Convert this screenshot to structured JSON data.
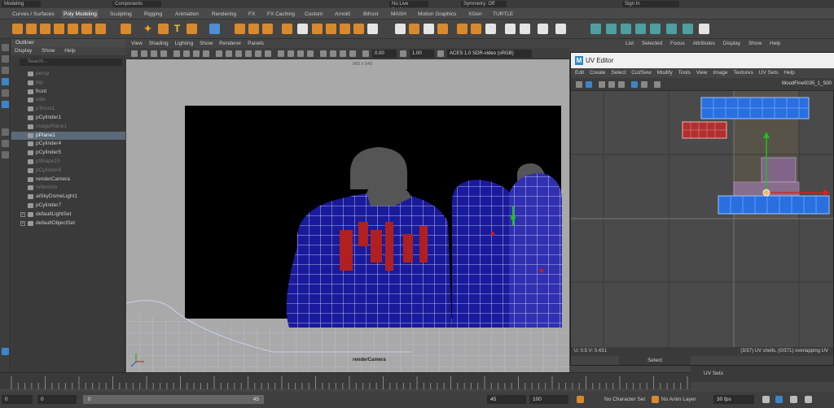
{
  "statusline": {
    "menuset": "Modeling",
    "components": "Components",
    "live_surface": "No Live Surface",
    "symmetry": "Symmetry: Off",
    "signin": "Sign In"
  },
  "shelf_tabs": [
    "Curves / Surfaces",
    "Poly Modeling",
    "Sculpting",
    "Rigging",
    "Animation",
    "Rendering",
    "FX",
    "FX Caching",
    "Custom",
    "Arnold",
    "Bifrost",
    "MASH",
    "Motion Graphics",
    "XGen",
    "TURTLE"
  ],
  "active_shelf_tab": "Poly Modeling",
  "outliner": {
    "title": "Outliner",
    "menu": [
      "Display",
      "Show",
      "Help"
    ],
    "search_placeholder": "Search...",
    "items": [
      {
        "label": "persp",
        "dim": true
      },
      {
        "label": "top",
        "dim": true
      },
      {
        "label": "front",
        "dim": false
      },
      {
        "label": "side",
        "dim": true
      },
      {
        "label": "pTorus1",
        "dim": true
      },
      {
        "label": "pCylinder1",
        "dim": false
      },
      {
        "label": "imagePlane1",
        "dim": true
      },
      {
        "label": "pPlane1",
        "dim": false,
        "highlight": true
      },
      {
        "label": "pCylinder4",
        "dim": false
      },
      {
        "label": "pCylinder5",
        "dim": false
      },
      {
        "label": "pShape15",
        "dim": true
      },
      {
        "label": "pCylinder6",
        "dim": true
      },
      {
        "label": "renderCamera",
        "dim": false
      },
      {
        "label": "reflection",
        "dim": true
      },
      {
        "label": "aiSkyDomeLight1",
        "dim": false
      },
      {
        "label": "pCylinder7",
        "dim": false
      },
      {
        "label": "defaultLightSet",
        "dim": false,
        "expandable": true
      },
      {
        "label": "defaultObjectSet",
        "dim": false,
        "expandable": true
      }
    ]
  },
  "viewport": {
    "menu": [
      "View",
      "Shading",
      "Lighting",
      "Show",
      "Renderer",
      "Panels"
    ],
    "field1": "0.00",
    "field2": "1.00",
    "color_space": "ACES 1.0 SDR-video (sRGB)",
    "resolution": "960 x 540",
    "camera": "renderCamera"
  },
  "right_menu": [
    "List",
    "Selected",
    "Focus",
    "Attributes",
    "Display",
    "Show",
    "Help"
  ],
  "uv_editor": {
    "title": "UV Editor",
    "menu": [
      "Edit",
      "Create",
      "Select",
      "Cut/Sew",
      "Modify",
      "Tools",
      "View",
      "Image",
      "Textures",
      "UV Sets",
      "Help"
    ],
    "texture_name": "WoodFine0035_1_S00",
    "status_left": "U: 0.5 V: 0.431",
    "status_right": "(3/37) UV shells, (0/371) overlapping UV",
    "select_label": "Select",
    "uv_sets_label": "UV Sets"
  },
  "time": {
    "start": "0",
    "range_start": "0",
    "range_mid": "45",
    "end": "45",
    "max": "100",
    "character_set": "No Character Set",
    "anim_layer": "No Anim Layer",
    "fps": "30 fps"
  },
  "colors": {
    "mesh_blue": "#1a1a9c",
    "mesh_red": "#b02020",
    "wire": "#e8e8ff",
    "uv_blue": "#2a6fe0",
    "accent": "#d9892d"
  }
}
